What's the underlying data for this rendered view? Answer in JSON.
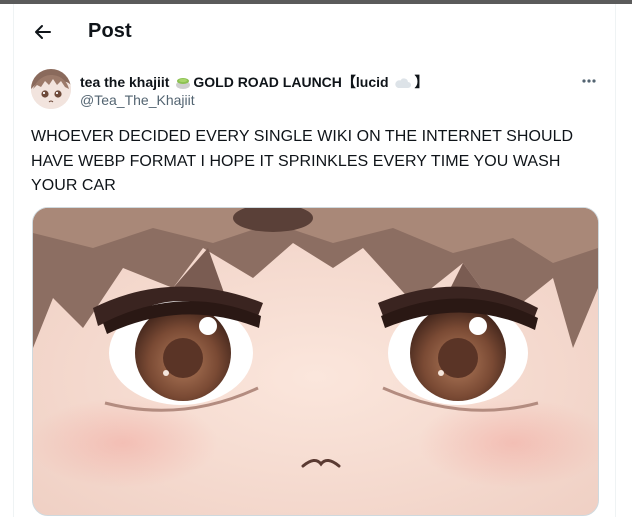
{
  "header": {
    "title": "Post"
  },
  "author": {
    "display_name_part1": "tea the khajiit",
    "display_name_part2": "GOLD ROAD LAUNCH【lucid",
    "display_name_part3": "】",
    "handle": "@Tea_The_Khajiit"
  },
  "post": {
    "text": "WHOEVER DECIDED EVERY SINGLE WIKI ON THE INTERNET SHOULD\nHAVE WEBP FORMAT I HOPE IT SPRINKLES EVERY TIME YOU WASH\nYOUR CAR"
  },
  "icons": {
    "back": "back-arrow-icon",
    "more": "more-options-icon",
    "name_emoji_1": "green-tea-icon",
    "name_emoji_2": "cloud-icon"
  },
  "colors": {
    "text": "#0f1419",
    "secondary": "#536471",
    "border": "#eff3f4"
  }
}
